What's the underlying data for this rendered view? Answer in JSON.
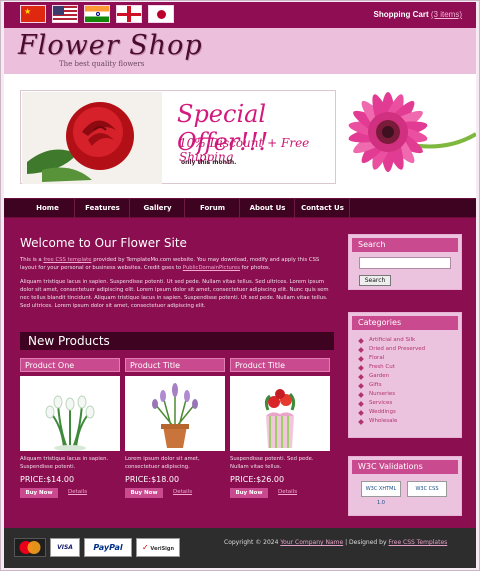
{
  "header": {
    "languages": [
      "China",
      "USA",
      "India",
      "England",
      "Japan"
    ],
    "cart_label": "Shopping Cart",
    "cart_count": "(3 items)"
  },
  "logo": {
    "title": "Flower Shop",
    "tagline": "The best quality flowers"
  },
  "banner": {
    "title": "Special Offer!!!",
    "line": "10% Discount + Free Shipping",
    "note": "only this month."
  },
  "nav": {
    "items": [
      "Home",
      "Features",
      "Gallery",
      "Forum",
      "About Us",
      "Contact Us"
    ]
  },
  "main": {
    "welcome": "Welcome to Our Flower Site",
    "intro": {
      "before_link1": "This is a ",
      "link1": "free CSS template",
      "after_link1": " provided by TemplateMo.com website. You may download, modify and apply this CSS layout for your personal or business websites. Credit goes to ",
      "link2": "PublicDomainPictures",
      "after_link2": " for photos."
    },
    "para2": "Aliquam tristique lacus in sapien. Suspendisse potenti. Ut sed pede. Nullam vitae tellus. Sed ultrices. Lorem ipsum dolor sit amet, consectetuer adipiscing elit. Lorem ipsum dolor sit amet, consectetuer adipiscing elit. Nunc quis sem nec tellus blandit tincidunt. Aliquam tristique lacus in sapien. Suspendisse potenti. Ut sed pede. Nullam vitae tellus. Sed ultrices. Lorem ipsum dolor sit amet, consectetuer adipiscing elit.",
    "new_products": "New Products",
    "products": [
      {
        "title": "Product One",
        "desc": "Aliquam tristique lacus in sapien. Suspendisse potenti.",
        "price": "PRICE:$14.00",
        "buy": "Buy Now",
        "details": "Details"
      },
      {
        "title": "Product Title",
        "desc": "Lorem ipsum dolor sit amet, consectetuer adipiscing.",
        "price": "PRICE:$18.00",
        "buy": "Buy Now",
        "details": "Details"
      },
      {
        "title": "Product Title",
        "desc": "Suspendisse potenti. Sed pede. Nullam vitae tellus.",
        "price": "PRICE:$26.00",
        "buy": "Buy Now",
        "details": "Details"
      }
    ]
  },
  "sidebar": {
    "search_title": "Search",
    "search_value": "",
    "search_button": "Search",
    "categories_title": "Categories",
    "categories": [
      "Artificial and Silk",
      "Dried and Preserved",
      "Floral",
      "Fresh Cut",
      "Garden",
      "Gifts",
      "Nurseries",
      "Services",
      "Weddings",
      "Wholesale"
    ],
    "w3c_title": "W3C Validations",
    "w3c_badges": [
      "W3C XHTML 1.0",
      "W3C CSS"
    ]
  },
  "footer": {
    "payment_cards": [
      "MasterCard",
      "VISA",
      "PayPal",
      "VeriSign"
    ],
    "copyright_prefix": "Copyright © 2024 ",
    "company": "Your Company Name",
    "designed_by": " | Designed by ",
    "designer": "Free CSS Templates"
  },
  "colors": {
    "primary": "#8a0e50",
    "dark": "#3e0320",
    "accent": "#c94a8e",
    "logo_band": "#ecbfdc"
  }
}
